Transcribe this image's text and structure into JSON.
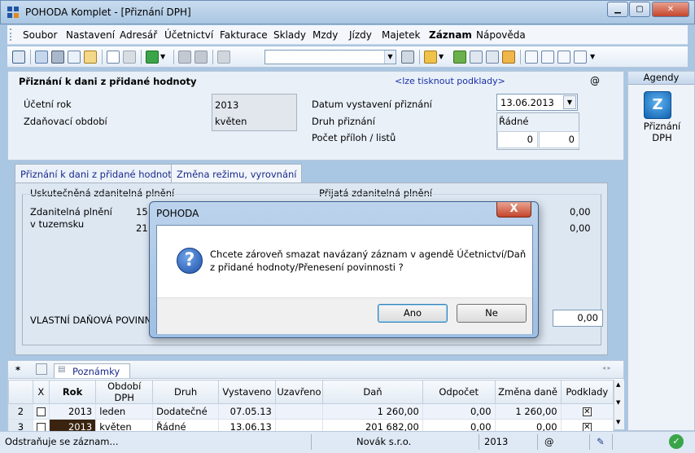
{
  "window": {
    "title": "POHODA Komplet - [Přiznání DPH]"
  },
  "menu": [
    {
      "label": "Soubor",
      "name": "menu-soubor"
    },
    {
      "label": "Nastavení",
      "name": "menu-nastaveni"
    },
    {
      "label": "Adresář",
      "name": "menu-adresar"
    },
    {
      "label": "Účetnictví",
      "name": "menu-ucetnictvi"
    },
    {
      "label": "Fakturace",
      "name": "menu-fakturace"
    },
    {
      "label": "Sklady",
      "name": "menu-sklady"
    },
    {
      "label": "Mzdy",
      "name": "menu-mzdy"
    },
    {
      "label": "Jízdy",
      "name": "menu-jizdy"
    },
    {
      "label": "Majetek",
      "name": "menu-majetek"
    },
    {
      "label": "Záznam",
      "name": "menu-zaznam"
    },
    {
      "label": "Nápověda",
      "name": "menu-napoveda"
    }
  ],
  "form": {
    "title": "Přiznání k dani z přidané hodnoty",
    "print_link": "<lze tisknout podklady>",
    "at_symbol": "@",
    "ucetni_rok_label": "Účetní rok",
    "ucetni_rok_value": "2013",
    "zdanovaci_obdobi_label": "Zdaňovací období",
    "zdanovaci_obdobi_value": "květen",
    "datum_label": "Datum vystavení přiznání",
    "datum_value": "13.06.2013",
    "druh_label": "Druh přiznání",
    "druh_value": "Řádné",
    "pocet_label": "Počet příloh / listů",
    "pocet_prilohy": "0",
    "pocet_listy": "0"
  },
  "tabs": [
    {
      "label": "Přiznání k dani z přidané hodnoty"
    },
    {
      "label": "Změna režimu, vyrovnání"
    }
  ],
  "panel": {
    "uskutecnena_label": "Uskutečněná zdanitelná plnění",
    "prijata_label": "Přijatá zdanitelná plnění",
    "zdanitelna_label": "Zdanitelná plnění",
    "tuzemsku_label": "v tuzemsku",
    "val_15": "15",
    "val_21": "21",
    "right_val1": "0,00",
    "right_val2": "0,00",
    "vlastni_label": "VLASTNÍ DAŇOVÁ POVINNOST",
    "vlastni_value": "0,00"
  },
  "sidebar": {
    "header": "Agendy",
    "item_label_1": "Přiznání",
    "item_label_2": "DPH"
  },
  "bottom": {
    "tab_star": "*",
    "notes_label": "Poznámky",
    "columns": [
      "",
      "X",
      "Rok",
      "Období DPH",
      "Druh",
      "Vystaveno",
      "Uzavřeno",
      "Daň",
      "Odpočet",
      "Změna daně",
      "Podklady"
    ],
    "rows": [
      {
        "num": "2",
        "rok": "2013",
        "obdobi": "leden",
        "druh": "Dodatečné",
        "vystaveno": "07.05.13",
        "uzavreno": "",
        "dan": "1 260,00",
        "odpocet": "0,00",
        "zmena": "1 260,00"
      },
      {
        "num": "3",
        "rok": "2013",
        "obdobi": "květen",
        "druh": "Řádné",
        "vystaveno": "13.06.13",
        "uzavreno": "",
        "dan": "201 682,00",
        "odpocet": "0,00",
        "zmena": "0,00"
      }
    ]
  },
  "status": {
    "message": "Odstraňuje se záznam...",
    "company": "Novák s.r.o.",
    "year": "2013",
    "at": "@"
  },
  "dialog": {
    "title": "POHODA",
    "message": "Chcete zároveň smazat navázaný záznam v agendě Účetnictví/Daň z přidané hodnoty/Přenesení povinnosti ?",
    "yes_label": "Ano",
    "no_label": "Ne",
    "close_glyph": "X"
  },
  "colors": {
    "accent": "#a9c6e2",
    "selected_cell": "#3a2410",
    "dialog_close": "#c4452d"
  }
}
